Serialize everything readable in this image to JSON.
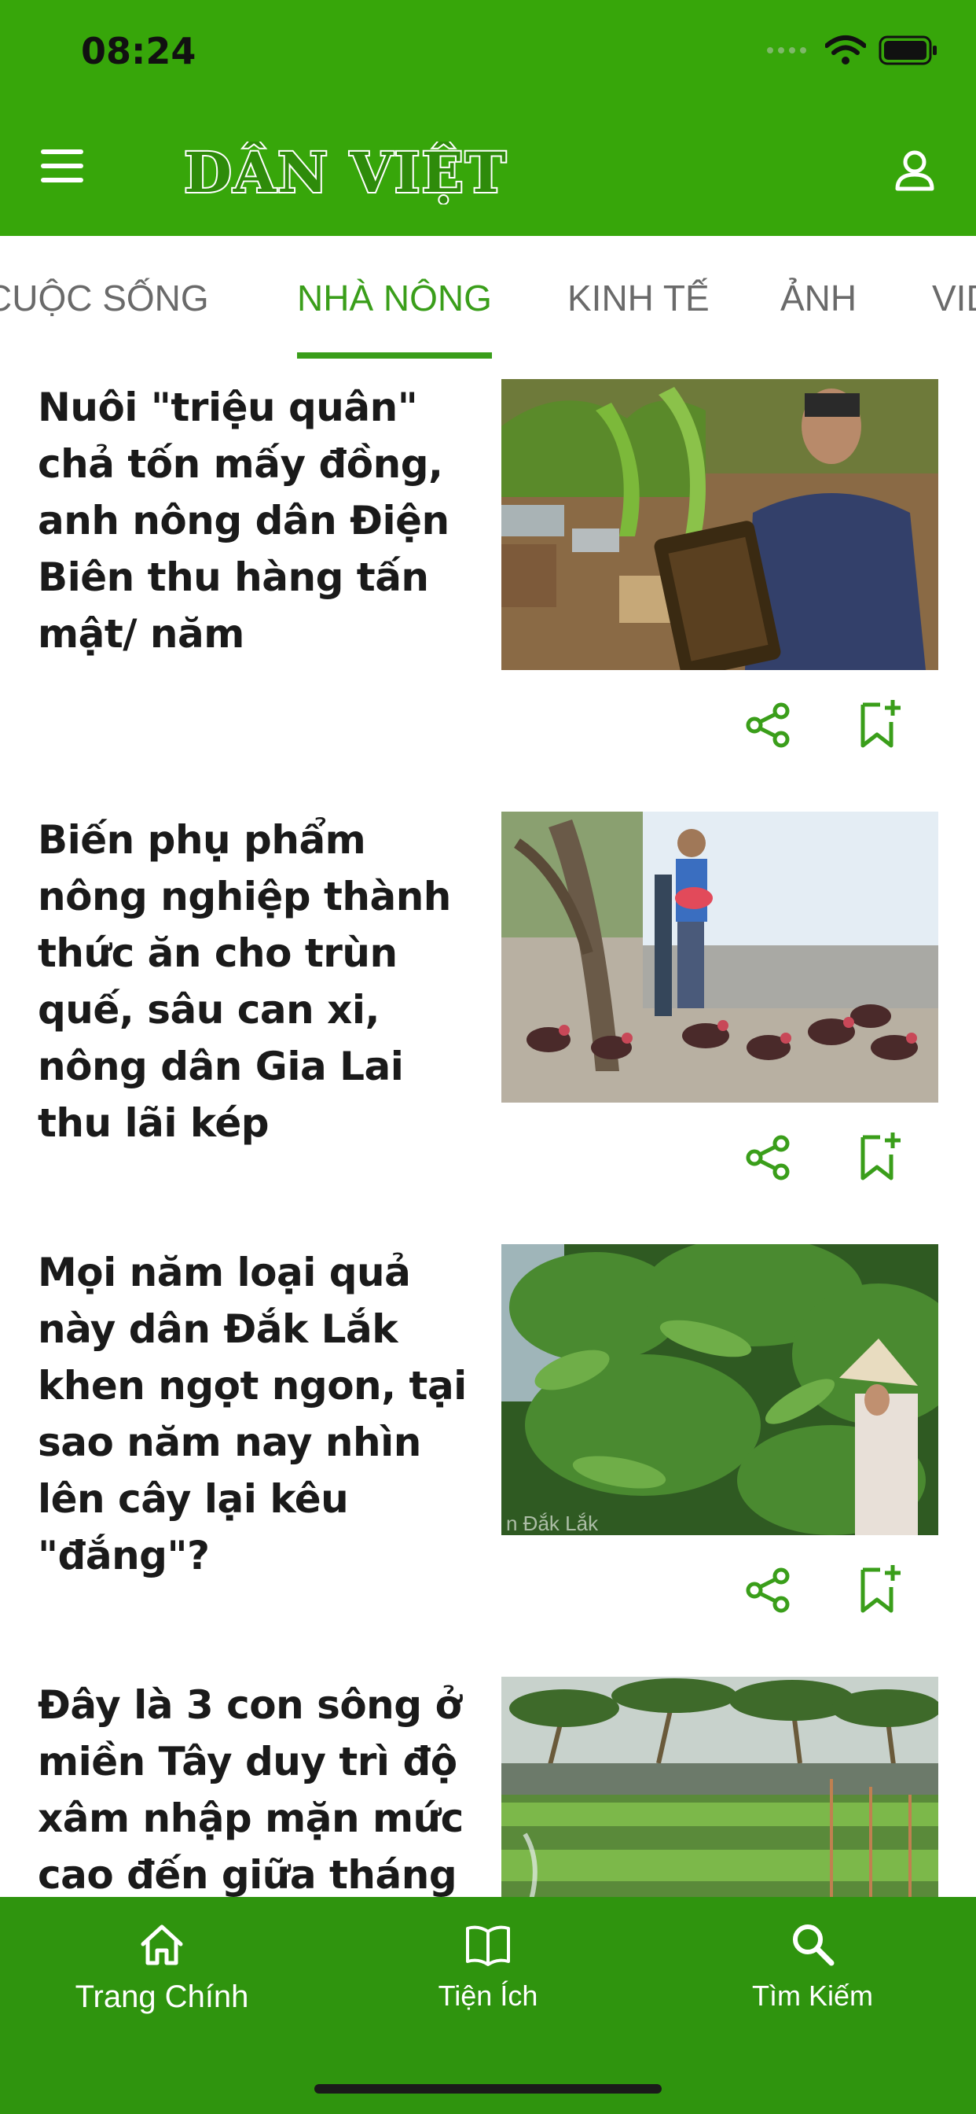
{
  "status_bar": {
    "time": "08:24"
  },
  "header": {
    "logo_text": "DÂN VIỆT"
  },
  "tabs": [
    {
      "label": "CUỘC SỐNG"
    },
    {
      "label": "NHÀ NÔNG"
    },
    {
      "label": "KINH TẾ"
    },
    {
      "label": "ẢNH"
    },
    {
      "label": "VIDEO"
    }
  ],
  "articles": [
    {
      "title": "Nuôi \"triệu quân\" chả tốn mấy đồng, anh nông dân Điện Biên thu hàng tấn mật/ năm",
      "image": "beekeeper-photo"
    },
    {
      "title": "Biến phụ phẩm nông nghiệp thành thức ăn cho trùn quế, sâu can xi, nông dân Gia Lai thu lãi kép",
      "image": "chicken-farm-photo"
    },
    {
      "title": "Mọi năm loại quả này dân Đắk Lắk khen ngọt ngon, tại sao năm nay nhìn lên cây lại kêu \"đắng\"?",
      "image": "fruit-tree-photo",
      "image_caption": "n Đắk Lắk"
    },
    {
      "title": "Đây là 3 con sông ở miền Tây duy trì độ xâm nhập mặn mức cao đến giữa tháng",
      "image": "field-irrigation-photo"
    }
  ],
  "bottom_nav": [
    {
      "label": "Trang Chính",
      "icon": "home-icon"
    },
    {
      "label": "Tiện Ích",
      "icon": "book-icon"
    },
    {
      "label": "Tìm Kiếm",
      "icon": "search-icon"
    }
  ],
  "colors": {
    "brand_green": "#37a60a",
    "active_tab": "#3a9e1a",
    "nav_green": "#2f940e"
  }
}
